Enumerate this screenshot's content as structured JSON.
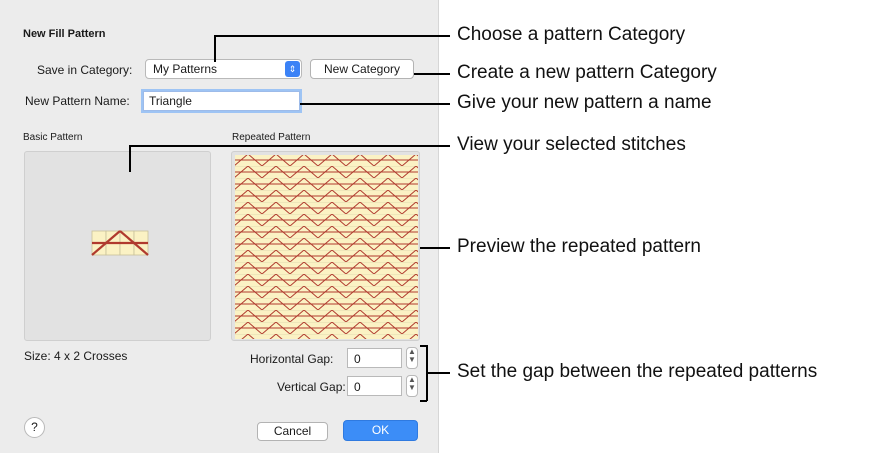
{
  "dialog": {
    "title": "New Fill Pattern",
    "save_in_label": "Save in Category:",
    "category_value": "My Patterns",
    "new_category_button": "New Category",
    "name_label": "New Pattern Name:",
    "name_value": "Triangle",
    "basic_label": "Basic Pattern",
    "repeated_label": "Repeated Pattern",
    "size_text": "Size: 4 x 2 Crosses",
    "hgap_label": "Horizontal Gap:",
    "hgap_value": "0",
    "vgap_label": "Vertical Gap:",
    "vgap_value": "0",
    "help_label": "?",
    "cancel_button": "Cancel",
    "ok_button": "OK"
  },
  "callouts": [
    "Choose a pattern Category",
    "Create a new pattern Category",
    "Give your new pattern a name",
    "View your selected stitches",
    "Preview the repeated pattern",
    "Set the gap between the repeated patterns"
  ],
  "colors": {
    "stitch_line": "#b03a2e",
    "cell_fill": "#fbf2c4",
    "accent": "#3c8df7"
  }
}
